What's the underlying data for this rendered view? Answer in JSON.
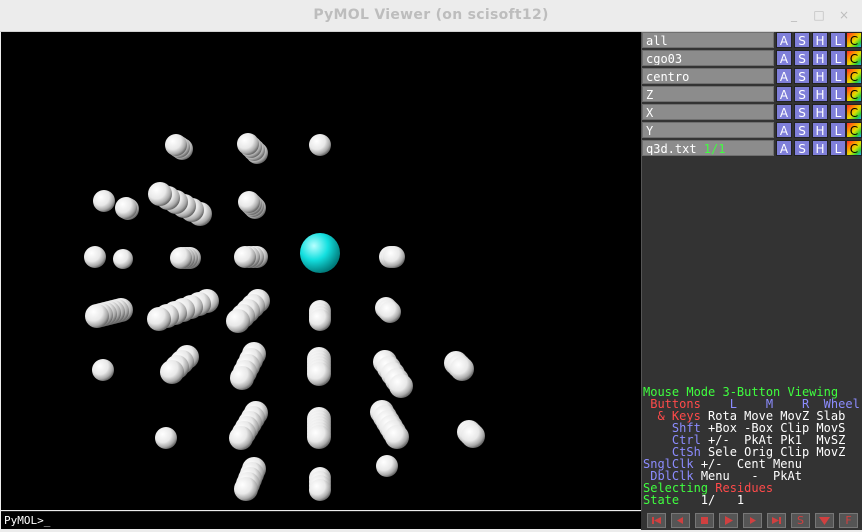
{
  "window": {
    "title": "PyMOL Viewer (on scisoft12)",
    "controls": {
      "minimize": "_",
      "maximize": "□",
      "close": "×"
    }
  },
  "command_line": {
    "prompt": "PyMOL>_"
  },
  "objects": [
    {
      "name": "all",
      "state": ""
    },
    {
      "name": "cgo03",
      "state": ""
    },
    {
      "name": "centro",
      "state": ""
    },
    {
      "name": "Z",
      "state": ""
    },
    {
      "name": "X",
      "state": ""
    },
    {
      "name": "Y",
      "state": ""
    },
    {
      "name": "q3d.txt",
      "state": "1/1"
    }
  ],
  "object_buttons": [
    "A",
    "S",
    "H",
    "L",
    "C"
  ],
  "mouse_mode": {
    "title_a": "Mouse Mode ",
    "title_b": "3-Button Viewing",
    "buttons_label": " Buttons",
    "col_l": "L",
    "col_m": "M",
    "col_r": "R",
    "col_wheel": "Wheel",
    "keys_label": "  & Keys",
    "keys_row": "Rota Move MovZ Slab",
    "shft_label": "Shft",
    "shft_row": "+Box -Box Clip MovS",
    "ctrl_label": "Ctrl",
    "ctrl_row": "+/-  PkAt Pk1  MvSZ",
    "ctsh_label": "CtSh",
    "ctsh_row": "Sele Orig Clip MovZ",
    "snglclk_label": "SnglClk",
    "snglclk_row": "+/-  Cent Menu",
    "dblclk_label": " DblClk",
    "dblclk_row": "Menu   -  PkAt",
    "selecting_a": "Selecting ",
    "selecting_b": "Residues",
    "state_label": "State",
    "state_value": "   1/   1"
  },
  "playback": [
    "first",
    "prev",
    "stop",
    "play",
    "next",
    "last",
    "S",
    "down",
    "F"
  ],
  "scene_colors": {
    "background": "#000000",
    "spheres": "#ffffff",
    "centro": "#00e0e0"
  }
}
